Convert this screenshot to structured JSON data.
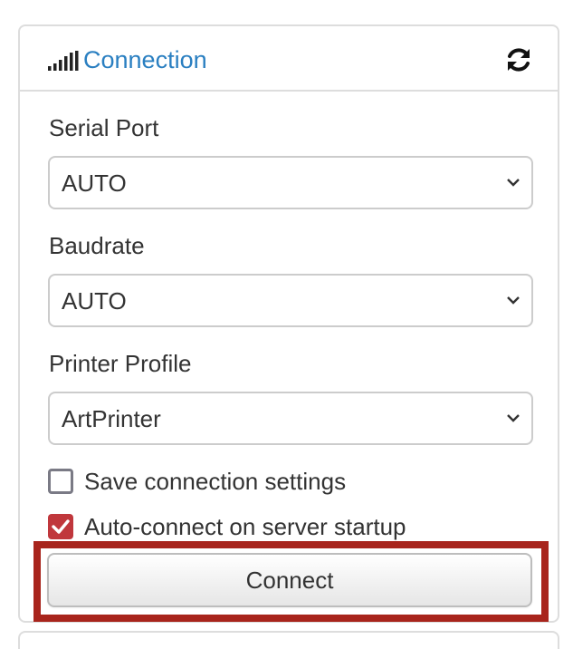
{
  "panel": {
    "title": "Connection",
    "icons": {
      "title_icon": "signal-icon",
      "refresh_icon": "refresh-icon"
    },
    "title_color": "#2a7fc1"
  },
  "serial_port": {
    "label": "Serial Port",
    "value": "AUTO"
  },
  "baudrate": {
    "label": "Baudrate",
    "value": "AUTO"
  },
  "printer_profile": {
    "label": "Printer Profile",
    "value": "ArtPrinter"
  },
  "save_settings": {
    "label": "Save connection settings",
    "checked": false
  },
  "auto_connect": {
    "label": "Auto-connect on server startup",
    "checked": true,
    "checkbox_color": "#c0373c"
  },
  "connect_button": {
    "label": "Connect",
    "highlight_color": "#a8241c"
  }
}
